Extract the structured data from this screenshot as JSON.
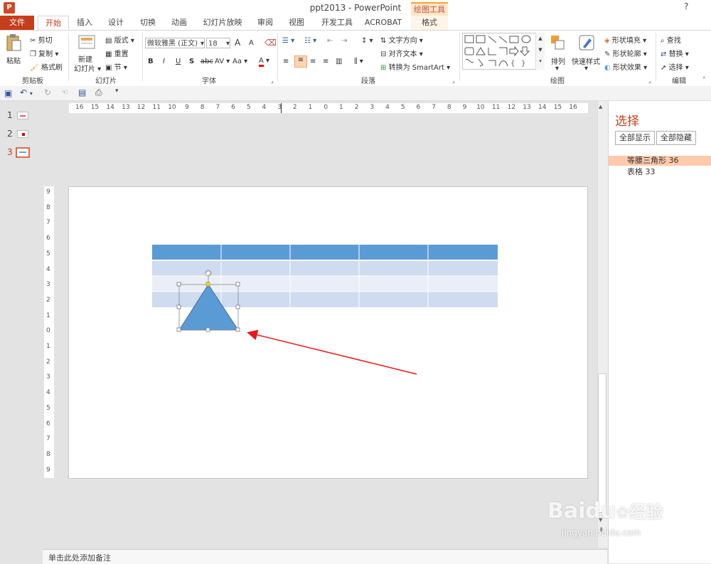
{
  "window": {
    "app_icon": "P",
    "title": "ppt2013 - PowerPoint",
    "help": "?",
    "minimize": "—",
    "restore": "□",
    "close": "✕"
  },
  "tabs": {
    "file": "文件",
    "home": "开始",
    "insert": "插入",
    "design": "设计",
    "transitions": "切换",
    "animations": "动画",
    "slideshow": "幻灯片放映",
    "review": "审阅",
    "view": "视图",
    "developer": "开发工具",
    "acrobat": "ACROBAT",
    "context_group": "绘图工具",
    "format": "格式"
  },
  "ribbon": {
    "clipboard": {
      "label": "剪贴板",
      "paste": "粘贴",
      "cut": "剪切",
      "copy": "复制",
      "format_painter": "格式刷"
    },
    "slides": {
      "label": "幻灯片",
      "new_slide_1": "新建",
      "new_slide_2": "幻灯片",
      "layout": "版式",
      "reset": "重置",
      "section": "节"
    },
    "font": {
      "label": "字体",
      "font_name": "微软雅黑 (正文)",
      "font_size": "18",
      "grow": "A",
      "shrink": "A",
      "bold": "B",
      "italic": "I",
      "underline": "U",
      "shadow": "S",
      "strike": "abc",
      "spacing": "AV",
      "case": "Aa",
      "color": "A"
    },
    "paragraph": {
      "label": "段落",
      "text_direction": "文字方向",
      "align_text": "对齐文本",
      "smartart": "转换为 SmartArt"
    },
    "drawing": {
      "label": "绘图",
      "arrange": "排列",
      "quick_styles": "快速样式",
      "shape_fill": "形状填充",
      "shape_outline": "形状轮廓",
      "shape_effects": "形状效果"
    },
    "editing": {
      "label": "编辑",
      "find": "查找",
      "replace": "替换",
      "select": "选择"
    }
  },
  "thumbnails": [
    {
      "num": "1"
    },
    {
      "num": "2"
    },
    {
      "num": "3"
    }
  ],
  "rulers": {
    "h_ticks": [
      "16",
      "15",
      "14",
      "13",
      "12",
      "11",
      "10",
      "9",
      "8",
      "7",
      "6",
      "5",
      "4",
      "3",
      "2",
      "1",
      "0",
      "1",
      "2",
      "3",
      "4",
      "5",
      "6",
      "7",
      "8",
      "9",
      "10",
      "11",
      "12",
      "13",
      "14",
      "15",
      "16"
    ],
    "v_ticks": [
      "9",
      "8",
      "7",
      "6",
      "5",
      "4",
      "3",
      "2",
      "1",
      "0",
      "1",
      "2",
      "3",
      "4",
      "5",
      "6",
      "7",
      "8",
      "9"
    ]
  },
  "notes": {
    "placeholder": "单击此处添加备注"
  },
  "selection_pane": {
    "title": "选择",
    "show_all": "全部显示",
    "hide_all": "全部隐藏",
    "items": [
      {
        "label": "等腰三角形 36",
        "selected": true
      },
      {
        "label": "表格 33",
        "selected": false
      }
    ]
  },
  "watermark": {
    "brand": "Baidu",
    "brand_cn": "经验",
    "url": "jingyan.baidu.com"
  },
  "colors": {
    "accent": "#c43e1c",
    "table_header": "#5b9bd5",
    "table_row_dark": "#cfdbef",
    "table_row_light": "#e9eef7",
    "triangle_fill": "#5b9bd5",
    "selection_highlight": "#fdc9ab",
    "arrow": "#e8191c"
  }
}
